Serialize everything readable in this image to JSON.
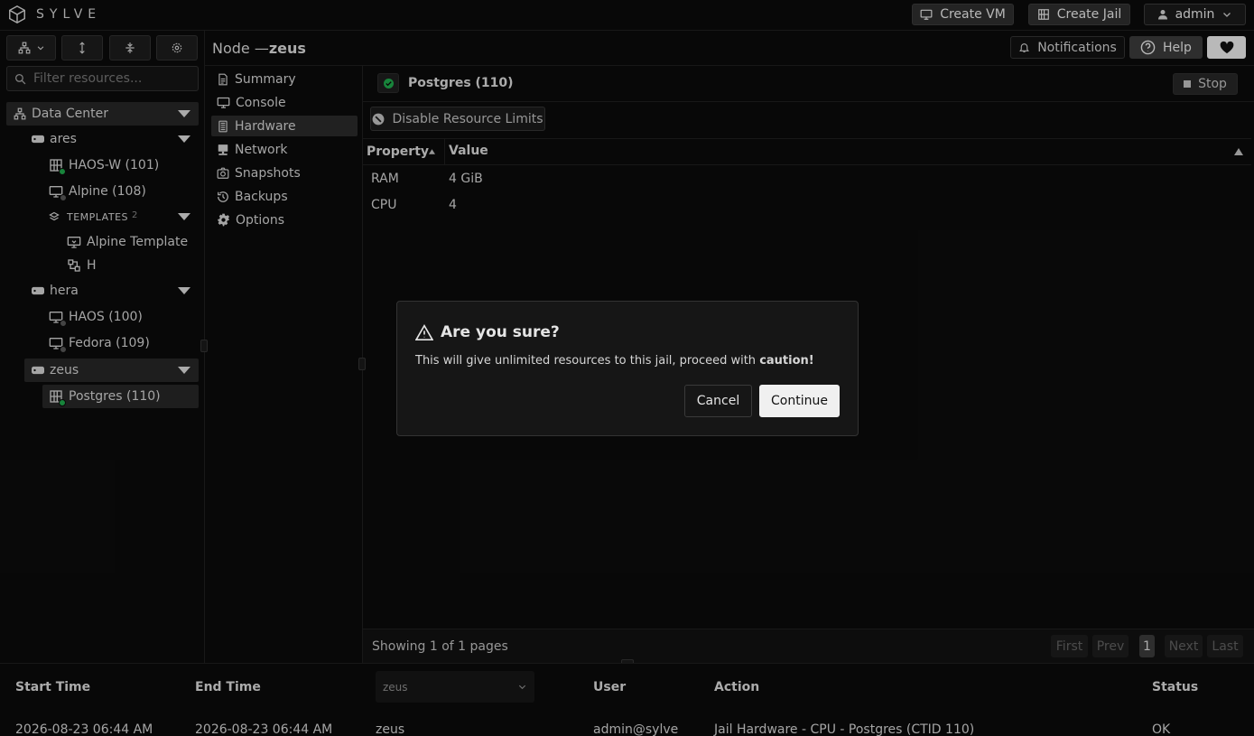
{
  "app": {
    "logo_text": "SYLVE"
  },
  "topbar": {
    "create_vm": "Create VM",
    "create_jail": "Create Jail",
    "user": "admin"
  },
  "toolbar": {
    "notifications": "Notifications",
    "help": "Help"
  },
  "sidebar": {
    "filter_placeholder": "Filter resources...",
    "datacenter": "Data Center",
    "nodes": [
      {
        "name": "ares",
        "items": [
          "HAOS-W (101)",
          "Alpine (108)"
        ],
        "templates_label": "TEMPLATES",
        "templates_count": "2",
        "templates": [
          "Alpine Template",
          "H"
        ]
      },
      {
        "name": "hera",
        "items": [
          "HAOS (100)",
          "Fedora (109)"
        ]
      },
      {
        "name": "zeus",
        "items": [
          "Postgres (110)"
        ]
      }
    ]
  },
  "node_title": {
    "prefix": "Node — ",
    "name": "zeus"
  },
  "menu": [
    "Summary",
    "Console",
    "Hardware",
    "Network",
    "Snapshots",
    "Backups",
    "Options"
  ],
  "resource": {
    "title": "Postgres (110)",
    "stop": "Stop",
    "disable_limits": "Disable Resource Limits"
  },
  "table": {
    "headers": [
      "Property",
      "Value"
    ],
    "rows": [
      [
        "RAM",
        "4 GiB"
      ],
      [
        "CPU",
        "4"
      ]
    ],
    "footer": "Showing 1 of 1 pages",
    "pager": {
      "first": "First",
      "prev": "Prev",
      "page": "1",
      "next": "Next",
      "last": "Last"
    }
  },
  "dialog": {
    "title": "Are you sure?",
    "message": "This will give unlimited resources to this jail, proceed with ",
    "emphasis": "caution!",
    "cancel": "Cancel",
    "continue": "Continue"
  },
  "tasks": {
    "headers": {
      "start": "Start Time",
      "end": "End Time",
      "node_select": "zeus",
      "user": "User",
      "action": "Action",
      "status": "Status"
    },
    "row": {
      "start": "2026-08-23 06:44 AM",
      "end": "2026-08-23 06:44 AM",
      "node": "zeus",
      "user": "admin@sylve",
      "action": "Jail Hardware - CPU - Postgres (CTID 110)",
      "status": "OK"
    }
  },
  "colors": {
    "running": "#1fa64a",
    "stopped": "#555555"
  }
}
